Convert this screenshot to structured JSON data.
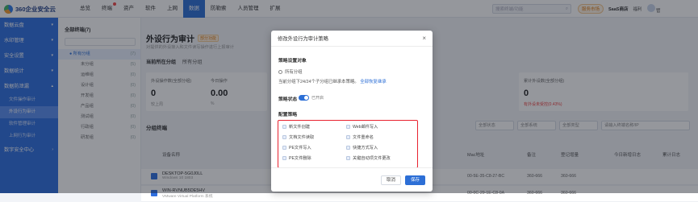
{
  "brand": {
    "name": "360企业安全云"
  },
  "topnav": {
    "items": [
      "总览",
      "终端",
      "资产",
      "软件",
      "上网",
      "数据",
      "防勒索",
      "人员管理",
      "扩展"
    ],
    "active": "数据"
  },
  "top_search": {
    "placeholder": "搜索终端/功能"
  },
  "top_right": {
    "service": "服务市场",
    "saas": "SaaS商店",
    "perks": "福利",
    "user": "管"
  },
  "sidebar": {
    "items": [
      {
        "label": "数据云盘"
      },
      {
        "label": "水印管理"
      },
      {
        "label": "安全设置"
      },
      {
        "label": "数据统计"
      },
      {
        "label": "数据防泄漏"
      }
    ],
    "subs": [
      "文件操作审计",
      "外设行为审计",
      "软件管理审计",
      "上网行为审计"
    ],
    "active_sub": "外设行为审计",
    "bottom": "数字安全中心"
  },
  "tree": {
    "title": "全部终端(7)",
    "rows": [
      {
        "label": "● 所有分组",
        "count": "(7)"
      },
      {
        "label": "未分组",
        "count": "(5)"
      },
      {
        "label": "运维组",
        "count": "(0)"
      },
      {
        "label": "设计组",
        "count": "(0)"
      },
      {
        "label": "开发组",
        "count": "(0)"
      },
      {
        "label": "产品组",
        "count": "(0)"
      },
      {
        "label": "测试组",
        "count": "(0)"
      },
      {
        "label": "行政组",
        "count": "(0)"
      },
      {
        "label": "研发组",
        "count": "(0)"
      }
    ]
  },
  "main": {
    "title": "外设行为审计",
    "tag": "部分功能",
    "desc": "对提供的外设接入和文件读写操作进行上报审计",
    "current_group_label": "当前所在分组",
    "current_group_value": "所有分组",
    "cards": [
      {
        "label": "外设操作数(全部分组)",
        "big": "0",
        "sub": "较上周"
      },
      {
        "label": "今日操作",
        "big": "0.00",
        "sub": "%"
      },
      {
        "label": "累计外设数(全部分组)",
        "big": "0",
        "sub": "有外设未受控(0.43%)"
      }
    ],
    "section": "分组终端",
    "filters": [
      "全部状态",
      "全部系统",
      "全部类型",
      "请输入终端名称/IP"
    ],
    "table": {
      "headers": [
        "设备名称",
        "Mac地址",
        "备注",
        "登记增量",
        "今日新增日志",
        "累计日志"
      ],
      "rows": [
        {
          "name": "DESKTOP-5G0J0LL",
          "os": "Windows 10 1803",
          "mac": "00-5E-35-C8-27-BC",
          "note": "360-666",
          "reg": "360-666"
        },
        {
          "name": "WIN-RVNUB5DE5HV",
          "os": "VMware Virtual Platform 系统",
          "mac": "00-0C-29-1E-C8-0A",
          "note": "360-666",
          "reg": "360-666"
        }
      ]
    }
  },
  "modal": {
    "title": "修改外设行为审计策略",
    "close": "×",
    "target_label": "策略设置对象",
    "target_value": "所有分组",
    "inherit_text": "当前分组下24/24个子分组已继承本策略。",
    "inherit_link": "全部恢复继承",
    "status_label": "策略状态",
    "status_text": "已开启",
    "config_label": "配置策略",
    "options_left": [
      "新文件创建",
      "文档文件读取",
      "PE文件写入",
      "PE文件删除"
    ],
    "options_right": [
      "Web邮件写入",
      "文件重命名",
      "快捷方式写入",
      "关键自动项文件更改"
    ],
    "cancel": "取消",
    "save": "保存"
  },
  "colors": {
    "accent": "#2d6fd6",
    "sidebar": "#2f6fe0",
    "highlight": "#e8222f"
  }
}
